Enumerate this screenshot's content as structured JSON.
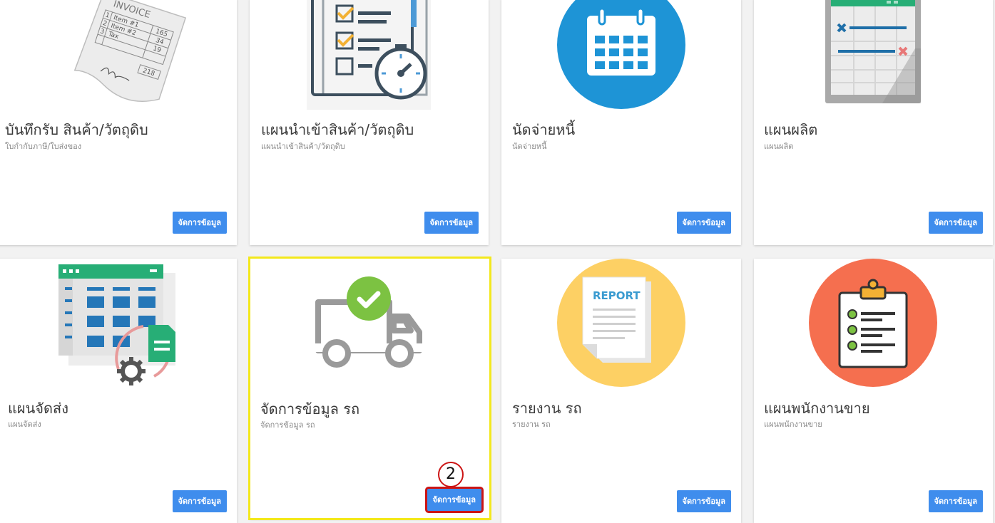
{
  "cards": [
    {
      "title": "บันทึกรับ สินค้า/วัตถุดิบ",
      "subtitle": "ใบกำกับภาษี/ใบส่งของ",
      "button": "จัดการข้อมูล",
      "icon": "invoice-icon"
    },
    {
      "title": "แผนนำเข้าสินค้า/วัตถุดิบ",
      "subtitle": "แผนนำเข้าสินค้า/วัตถุดิบ",
      "button": "จัดการข้อมูล",
      "icon": "checklist-stopwatch-icon"
    },
    {
      "title": "นัดจ่ายหนี้",
      "subtitle": "นัดจ่ายหนี้",
      "button": "จัดการข้อมูล",
      "icon": "calendar-icon"
    },
    {
      "title": "แผนผลิต",
      "subtitle": "แผนผลิต",
      "button": "จัดการข้อมูล",
      "icon": "spreadsheet-icon"
    },
    {
      "title": "แผนจัดส่ง",
      "subtitle": "แผนจัดส่ง",
      "button": "จัดการข้อมูล",
      "icon": "sheet-gear-icon"
    },
    {
      "title": "จัดการข้อมูล รถ",
      "subtitle": "จัดการข้อมูล รถ",
      "button": "จัดการข้อมูล",
      "icon": "truck-check-icon"
    },
    {
      "title": "รายงาน รถ",
      "subtitle": "รายงาน รถ",
      "button": "จัดการข้อมูล",
      "icon": "report-icon"
    },
    {
      "title": "แผนพนักงานขาย",
      "subtitle": "แผนพนักงานขาย",
      "button": "จัดการข้อมูล",
      "icon": "clipboard-icon"
    }
  ],
  "invoice_art": {
    "header": "INVOICE",
    "rows": [
      [
        "1",
        "Item #1",
        "165"
      ],
      [
        "2",
        "Item #2",
        "34"
      ],
      [
        "3",
        "Tax",
        "19"
      ]
    ],
    "total": "218"
  },
  "report_art": {
    "label": "REPORT"
  },
  "annotation": {
    "step": "2"
  },
  "colors": {
    "button": "#3f8ded",
    "highlight": "#f3e81c",
    "marker": "#cc1515"
  }
}
